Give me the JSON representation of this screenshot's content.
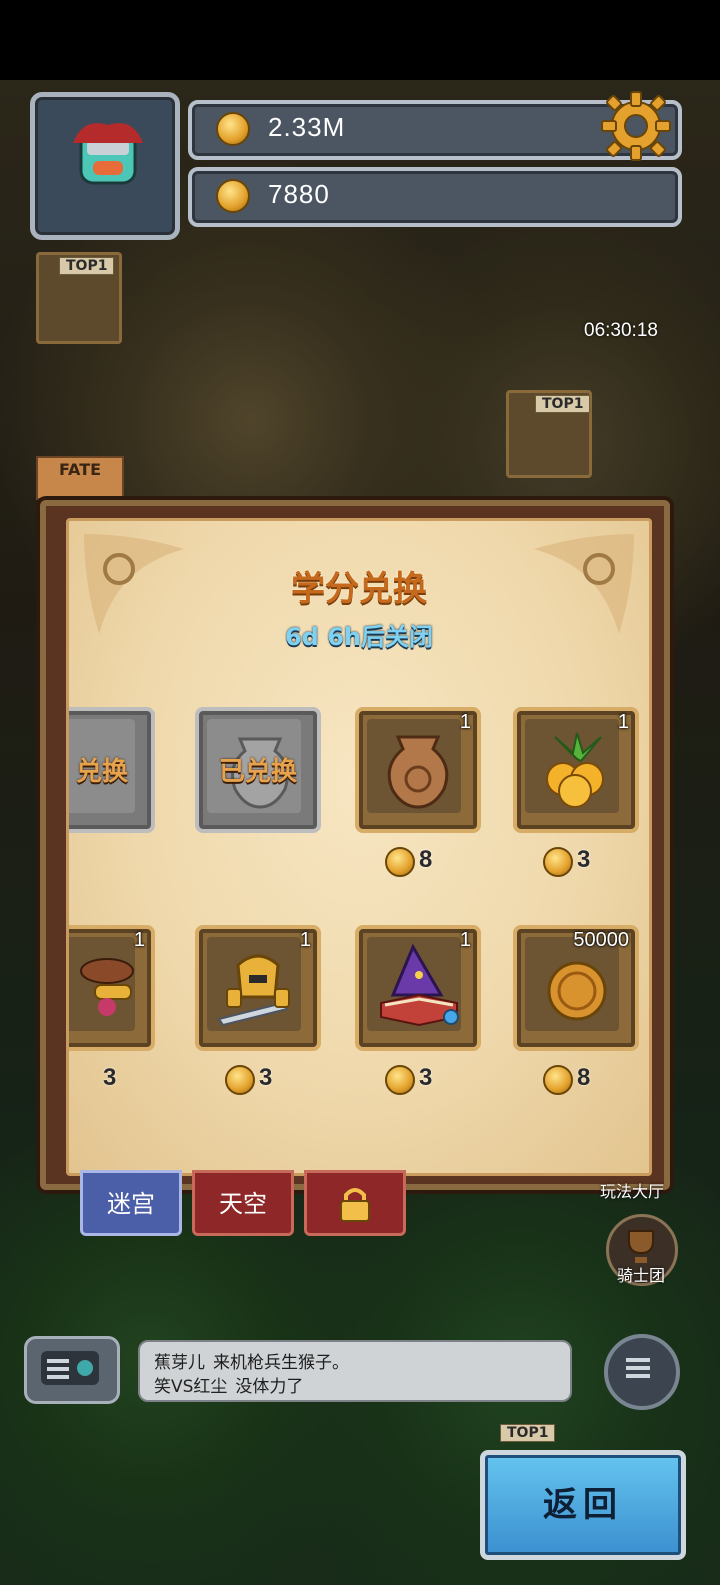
{
  "hud": {
    "gold": "2.33M",
    "credits": "7880",
    "timer": "06:30:18",
    "fate_label": "FATE",
    "top_tags": [
      "TOP1",
      "TOP1",
      "TOP1"
    ]
  },
  "modal": {
    "title": "学分兑换",
    "subtitle": "6d 6h后关闭",
    "items": [
      {
        "name": "partial-claimed",
        "claimed_label": "兑换",
        "claimed": true
      },
      {
        "name": "urn-claimed",
        "claimed_label": "已兑换",
        "claimed": true
      },
      {
        "name": "bronze-urn",
        "qty": "1",
        "price": "8"
      },
      {
        "name": "golden-fruit",
        "qty": "1",
        "price": "3"
      },
      {
        "name": "spyglass-hat",
        "qty": "1",
        "price": "3"
      },
      {
        "name": "knight-helmet-sword",
        "qty": "1",
        "price": "3"
      },
      {
        "name": "wizard-hat-book",
        "qty": "1",
        "price": "3"
      },
      {
        "name": "gold-coin",
        "qty": "50000",
        "price": "8"
      }
    ]
  },
  "tabs": {
    "maze": "迷宫",
    "sky": "天空"
  },
  "side": {
    "guild_label": "骑士团",
    "play_label": "玩法大厅"
  },
  "chat": {
    "line1_user": "蕉芽儿",
    "line1_text": "来机枪兵生猴子。",
    "line2_user": "笑VS红尘",
    "line2_text": "没体力了"
  },
  "back_label": "返回",
  "colors": {
    "title": "#c56a1c",
    "subtitle": "#7fd1f2",
    "back_button": "#3b8fcf"
  }
}
